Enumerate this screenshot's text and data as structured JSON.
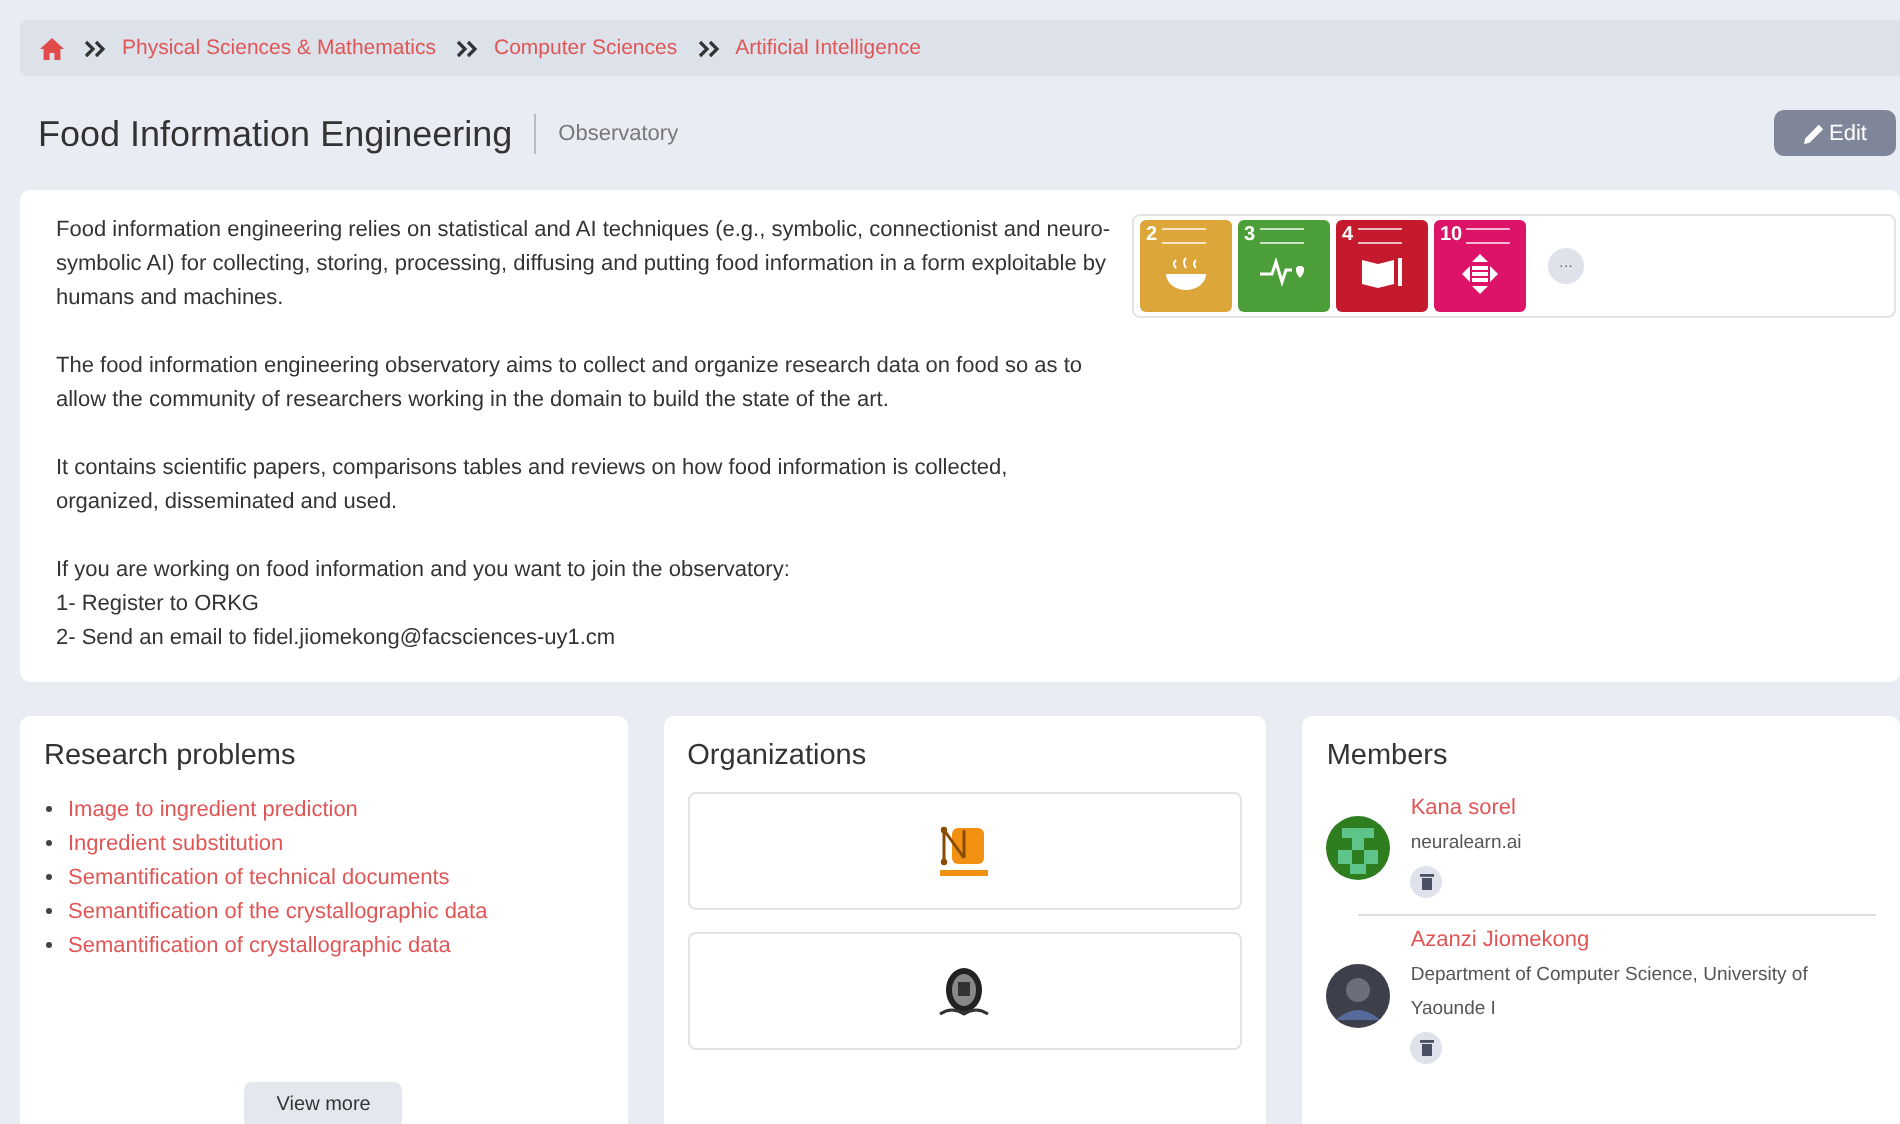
{
  "breadcrumb": [
    {
      "label": "Physical Sciences & Mathematics"
    },
    {
      "label": "Computer Sciences"
    },
    {
      "label": "Artificial Intelligence"
    }
  ],
  "header": {
    "title": "Food Information Engineering",
    "subtitle": "Observatory",
    "edit_button": "Edit"
  },
  "description": {
    "paragraphs": [
      "Food information engineering relies on statistical and AI techniques (e.g., symbolic, connectionist and neuro-symbolic AI) for collecting, storing, processing, diffusing and putting food information in a form exploitable by humans and machines.",
      "The food information engineering observatory aims to collect and organize research data on food so as to allow the community of researchers working in the domain to build the state of the art.",
      "It contains scientific papers, comparisons tables and reviews on how food information is collected, organized, disseminated and used.",
      "If you are working on food information and you want to join the observatory:\n1- Register to ORKG\n2- Send an email to fidel.jiomekong@facsciences-uy1.cm"
    ],
    "sdgs": [
      {
        "number": "2",
        "kind": "bowl",
        "color": "#dda63a"
      },
      {
        "number": "3",
        "kind": "pulse",
        "color": "#4c9f38"
      },
      {
        "number": "4",
        "kind": "book",
        "color": "#c5192d"
      },
      {
        "number": "10",
        "kind": "arrows",
        "color": "#dd1367"
      }
    ],
    "more_button": "···"
  },
  "research_problems": {
    "title": "Research problems",
    "items": [
      "Image to ingredient prediction",
      "Ingredient substitution",
      "Semantification of technical documents",
      "Semantification of the crystallographic data",
      "Semantification of crystallographic data"
    ],
    "button": "View more"
  },
  "organizations": {
    "title": "Organizations",
    "items": [
      {
        "kind": "orange"
      },
      {
        "kind": "seal"
      }
    ]
  },
  "members": {
    "title": "Members",
    "items": [
      {
        "name": "Kana sorel",
        "affiliation": "neuralearn.ai",
        "kind": "pattern"
      },
      {
        "name": "Azanzi Jiomekong",
        "affiliation": "Department of Computer Science, University of Yaounde I",
        "kind": "photo"
      }
    ]
  }
}
